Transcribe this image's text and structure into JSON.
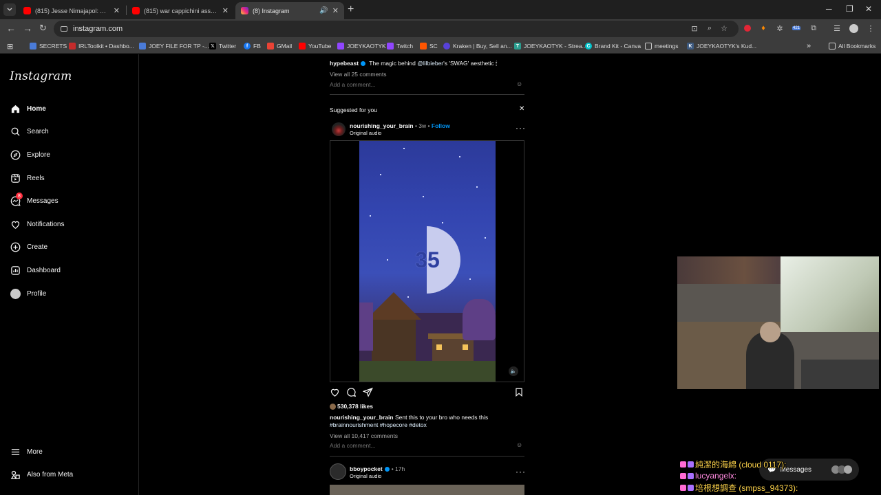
{
  "browser": {
    "tabs": [
      {
        "title": "(815) Jesse Nimajapol: An Inten",
        "active": false,
        "icon": "youtube-icon"
      },
      {
        "title": "(815) war cappichini assassini w",
        "active": false,
        "icon": "youtube-icon"
      },
      {
        "title": "(8) Instagram",
        "active": true,
        "icon": "instagram-icon"
      }
    ],
    "url": "instagram.com",
    "bookmarks": [
      "SECRETS",
      "IRLToolkit • Dashbo...",
      "JOEY FILE FOR TP -...",
      "Twitter",
      "FB",
      "GMail",
      "YouTube",
      "JOEYKAOTYK",
      "Twitch",
      "SC",
      "Kraken | Buy, Sell an...",
      "JOEYKAOTYK - Strea...",
      "Brand Kit - Canva",
      "meetings",
      "JOEYKAOTYK's Kud..."
    ],
    "all_bookmarks": "All Bookmarks",
    "extension_badge": "421"
  },
  "sidebar": {
    "logo": "Instagram",
    "items": [
      {
        "label": "Home",
        "icon": "home-icon"
      },
      {
        "label": "Search",
        "icon": "search-icon"
      },
      {
        "label": "Explore",
        "icon": "explore-icon"
      },
      {
        "label": "Reels",
        "icon": "reels-icon"
      },
      {
        "label": "Messages",
        "icon": "messages-icon",
        "badge": "8"
      },
      {
        "label": "Notifications",
        "icon": "heart-icon"
      },
      {
        "label": "Create",
        "icon": "plus-icon"
      },
      {
        "label": "Dashboard",
        "icon": "dashboard-icon"
      },
      {
        "label": "Profile",
        "icon": "profile-icon"
      }
    ],
    "more": "More",
    "also_from_meta": "Also from Meta"
  },
  "prev_post": {
    "username": "hypebeast",
    "caption_prefix": "The magic behind",
    "mention": "@lilbieber",
    "caption_suffix": "'s 'SWAG' aesthetic 🕯",
    "view_comments": "View all 25 comments",
    "add_comment": "Add a comment..."
  },
  "suggested": {
    "header": "Suggested for you"
  },
  "post": {
    "username": "nourishing_your_brain",
    "age": "3w",
    "follow": "Follow",
    "audio": "Original audio",
    "video_counter": "35",
    "likes": "530,378 likes",
    "caption": "Sent this to your bro who needs this",
    "hashtags": "#brainnourishment #hopecore #detox",
    "view_comments": "View all 10,417 comments",
    "add_comment": "Add a comment..."
  },
  "next_post": {
    "username": "bboypocket",
    "age": "17h",
    "audio": "Original audio"
  },
  "stream_chat": {
    "lines": [
      {
        "text": "純潔的海綿 (cloud 0117):"
      },
      {
        "text": "lucyangelx:"
      },
      {
        "text": "培根想調查 (smpss_94373):"
      }
    ],
    "messages_pill": "Messages"
  },
  "colors": {
    "accent_blue": "#0095f6",
    "badge_red": "#ff3040",
    "chat_yellow": "#ffd44a"
  }
}
